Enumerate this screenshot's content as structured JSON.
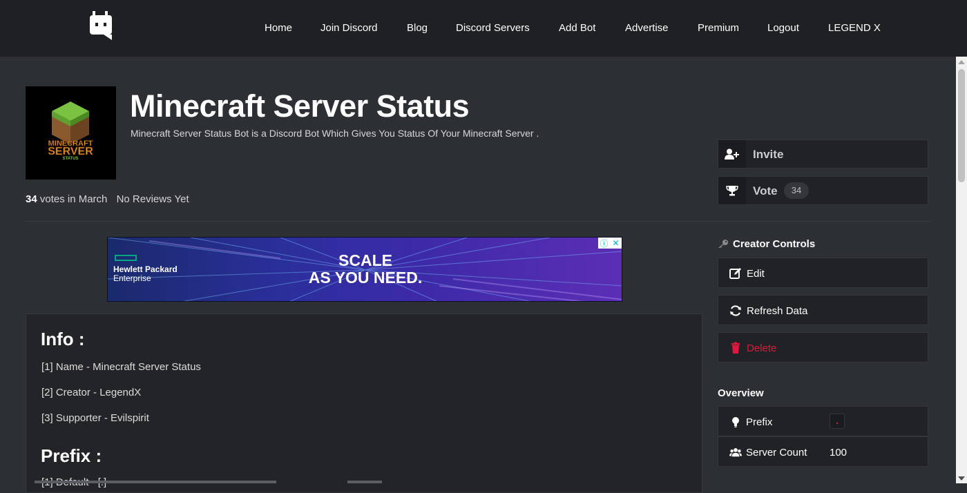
{
  "nav": {
    "items": [
      "Home",
      "Join Discord",
      "Blog",
      "Discord Servers",
      "Add Bot",
      "Advertise",
      "Premium",
      "Logout",
      "LEGEND X"
    ]
  },
  "bot": {
    "avatar_text": [
      "MINECRAFT",
      "SERVER",
      "STATUS"
    ],
    "title": "Minecraft Server Status",
    "description": "Minecraft Server Status Bot is a Discord Bot Which Gives You Status Of Your Minecraft Server .",
    "votes_count": "34",
    "votes_suffix": "votes in March",
    "reviews": "No Reviews Yet"
  },
  "actions": {
    "invite_label": "Invite",
    "vote_label": "Vote",
    "vote_count": "34"
  },
  "ad": {
    "brand_line1": "Hewlett Packard",
    "brand_line2": "Enterprise",
    "headline_line1": "SCALE",
    "headline_line2": "AS YOU NEED.",
    "info_glyph": "ⓘ",
    "close_glyph": "✕"
  },
  "info": {
    "heading": "Info :",
    "lines": [
      "[1] Name - Minecraft Server Status",
      "[2] Creator - LegendX",
      "[3] Supporter - Evilspirit"
    ],
    "prefix_heading": "Prefix :",
    "prefix_line": "[1] Default - [.]"
  },
  "creator_controls": {
    "heading": "Creator Controls",
    "edit": "Edit",
    "refresh": "Refresh Data",
    "delete": "Delete"
  },
  "overview": {
    "heading": "Overview",
    "prefix_label": "Prefix",
    "prefix_value": ".",
    "server_count_label": "Server Count",
    "server_count_value": "100"
  },
  "colors": {
    "navbar_bg": "#1f2023",
    "page_bg": "#2c2f33",
    "panel_bg": "#202225",
    "delete_red": "#e3173e"
  }
}
